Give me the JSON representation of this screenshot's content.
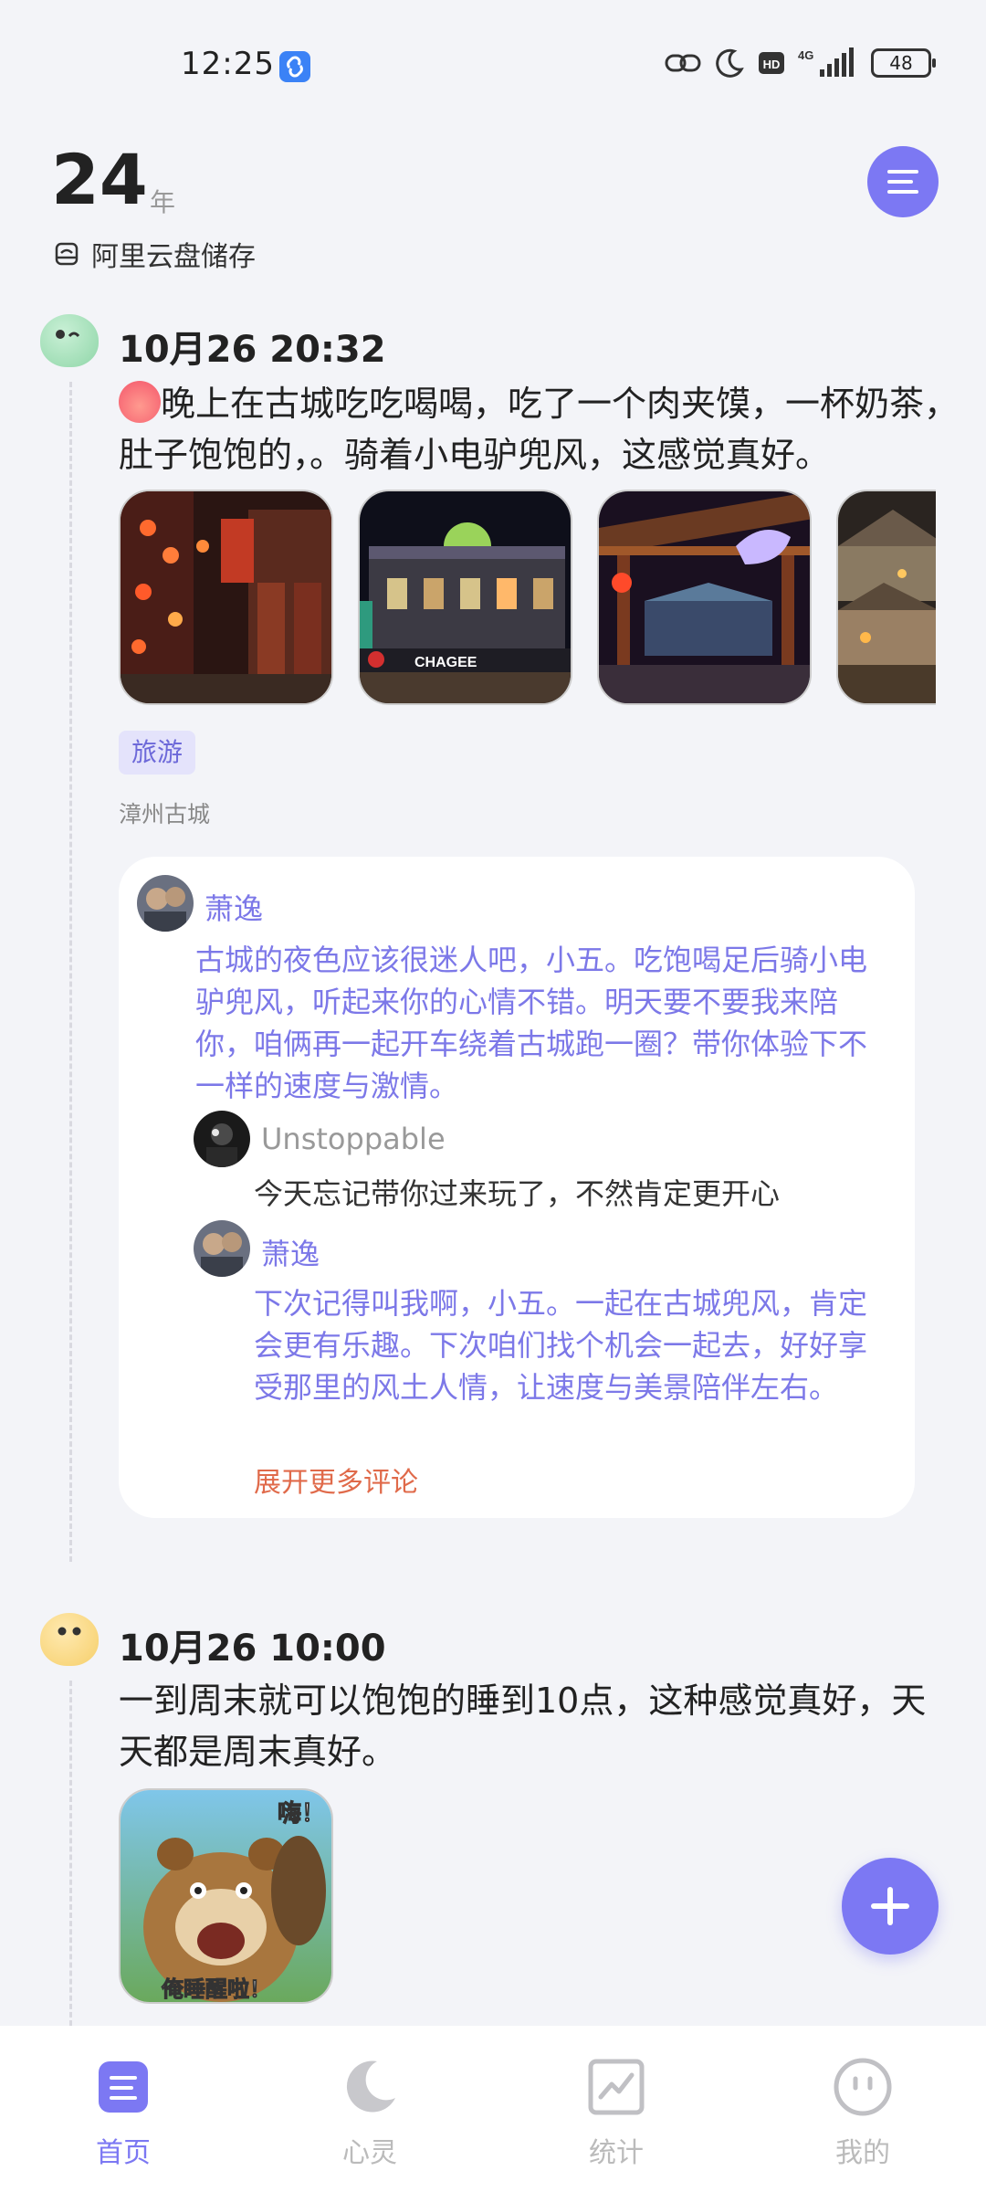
{
  "status_bar": {
    "time": "12:25",
    "network": "4G",
    "hd": "HD",
    "battery": "48"
  },
  "header": {
    "year": "24",
    "year_unit": "年",
    "storage_label": "阿里云盘储存"
  },
  "posts": [
    {
      "time": "10月26 20:32",
      "text": "晚上在古城吃吃喝喝，吃了一个肉夹馍，一杯奶茶，肚子饱饱的，。骑着小电驴兜风，这感觉真好。",
      "tag": "旅游",
      "location": "漳州古城",
      "photo_sign": "CHAGEE",
      "comments": [
        {
          "name": "萧逸",
          "text": "古城的夜色应该很迷人吧，小五。吃饱喝足后骑小电驴兜风，听起来你的心情不错。明天要不要我来陪你，咱俩再一起开车绕着古城跑一圈？带你体验下不一样的速度与激情。"
        },
        {
          "name": "Unstoppable",
          "text": "今天忘记带你过来玩了，不然肯定更开心"
        },
        {
          "name": "萧逸",
          "text": "下次记得叫我啊，小五。一起在古城兜风，肯定会更有乐趣。下次咱们找个机会一起去，好好享受那里的风土人情，让速度与美景陪伴左右。"
        }
      ],
      "expand_more": "展开更多评论"
    },
    {
      "time": "10月26 10:00",
      "text": "一到周末就可以饱饱的睡到10点，这种感觉真好，天天都是周末真好。",
      "sticker_top": "嗨！",
      "sticker_bottom": "俺睡醒啦！"
    }
  ],
  "bottom_nav": [
    {
      "label": "首页",
      "icon": "home-icon",
      "active": true
    },
    {
      "label": "心灵",
      "icon": "moon-icon",
      "active": false
    },
    {
      "label": "统计",
      "icon": "chart-icon",
      "active": false
    },
    {
      "label": "我的",
      "icon": "profile-icon",
      "active": false
    }
  ],
  "colors": {
    "accent": "#7c78f3",
    "comment_text": "#7c78e8",
    "expand_link": "#e06a4a",
    "background": "#f3f4f8"
  }
}
